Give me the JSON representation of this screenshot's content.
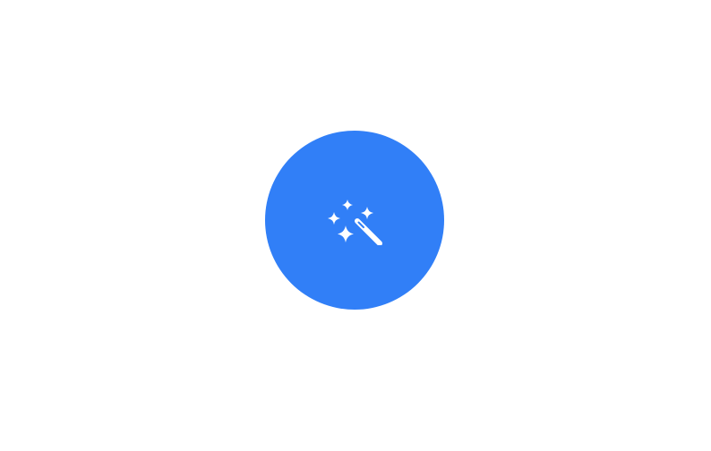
{
  "magic_button": {
    "icon": "magic-wand-sparkles-icon",
    "accent_color": "#317ff7",
    "icon_color": "#ffffff"
  }
}
